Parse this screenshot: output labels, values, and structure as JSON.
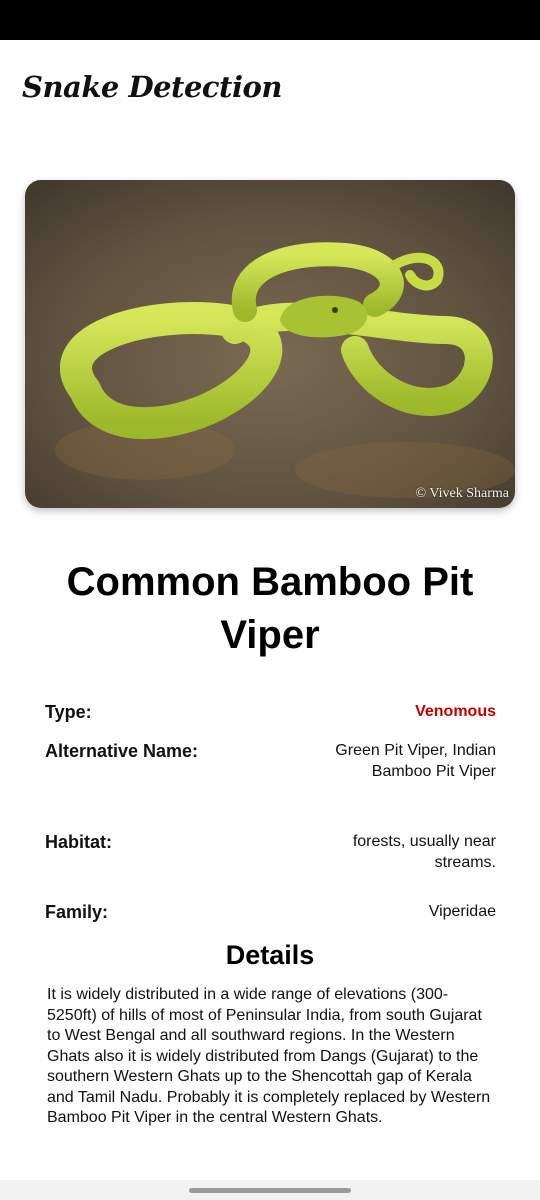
{
  "app": {
    "title": "Snake Detection"
  },
  "image": {
    "credit": "© Vivek Sharma"
  },
  "snake": {
    "name": "Common Bamboo Pit Viper",
    "info": [
      {
        "label": "Type:",
        "value": "Venomous"
      },
      {
        "label": "Alternative Name:",
        "value": "Green Pit Viper, Indian Bamboo Pit Viper"
      },
      {
        "label": "Habitat:",
        "value": "forests, usually near streams."
      },
      {
        "label": "Family:",
        "value": "Viperidae"
      }
    ]
  },
  "details": {
    "title": "Details",
    "text": "It is widely distributed in a wide range of elevations (300-5250ft) of hills of most of Peninsular India, from south Gujarat to West Bengal and all southward regions. In the Western Ghats also it is widely distributed from Dangs (Gujarat) to the southern Western Ghats up to the Shencottah gap of Kerala and Tamil Nadu. Probably it is completely replaced by Western Bamboo Pit Viper in the central Western Ghats."
  },
  "colors": {
    "venomous": "#c40000",
    "snake_green": "#b8d23a",
    "ground_brown": "#6b5b45"
  }
}
